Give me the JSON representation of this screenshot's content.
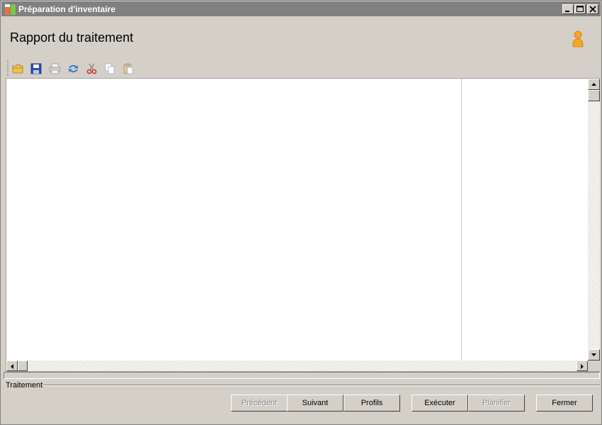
{
  "window": {
    "title": "Préparation d'inventaire"
  },
  "header": {
    "title": "Rapport du traitement"
  },
  "toolbar": {
    "items": [
      {
        "name": "open-folder-icon",
        "enabled": true
      },
      {
        "name": "save-icon",
        "enabled": true
      },
      {
        "name": "print-icon",
        "enabled": false
      },
      {
        "name": "refresh-icon",
        "enabled": true
      },
      {
        "name": "cut-icon",
        "enabled": true
      },
      {
        "name": "copy-icon",
        "enabled": false
      },
      {
        "name": "paste-icon",
        "enabled": false
      }
    ]
  },
  "progress": {
    "value": 0.0
  },
  "status": {
    "group_label": "Traitement"
  },
  "buttons": {
    "previous": "Précédent",
    "next": "Suivant",
    "profiles": "Profils",
    "execute": "Exécuter",
    "schedule": "Planifier",
    "close": "Fermer"
  },
  "colors": {
    "titlebar": "#808080",
    "background": "#d4d0c8",
    "accent_user_icon": "#f5a623"
  }
}
